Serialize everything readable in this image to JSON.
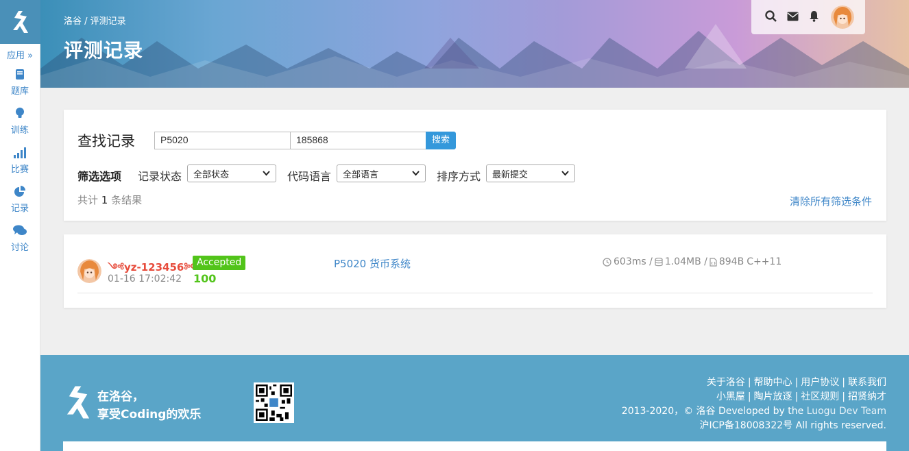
{
  "sidebar": {
    "apps_label": "应用 »",
    "items": [
      {
        "label": "题库",
        "icon": "book-icon"
      },
      {
        "label": "训练",
        "icon": "lightbulb-icon"
      },
      {
        "label": "比赛",
        "icon": "bar-chart-icon"
      },
      {
        "label": "记录",
        "icon": "pie-chart-icon"
      },
      {
        "label": "讨论",
        "icon": "comments-icon"
      }
    ]
  },
  "header": {
    "breadcrumb": "洛谷 / 评测记录",
    "title": "评测记录"
  },
  "search": {
    "find_label": "查找记录",
    "problem_value": "P5020",
    "user_value": "185868",
    "button_label": "搜索"
  },
  "filters": {
    "title": "筛选选项",
    "status_label": "记录状态",
    "status_value": "全部状态",
    "language_label": "代码语言",
    "language_value": "全部语言",
    "order_label": "排序方式",
    "order_value": "最新提交",
    "count_prefix": "共计",
    "count_value": "1",
    "count_suffix": "条结果",
    "clear_label": "清除所有筛选条件"
  },
  "record": {
    "username": "yz-123456",
    "time": "01-16 17:02:42",
    "status": "Accepted",
    "score": "100",
    "problem": "P5020 货币系统",
    "time_used": "603ms",
    "memory": "1.04MB",
    "code_size": "894B",
    "language": "C++11",
    "status_color": "#52c41a",
    "username_color": "#e74c3c"
  },
  "footer": {
    "slogan_line1": "在洛谷，",
    "slogan_line2": "享受Coding的欢乐",
    "links_row1": [
      "关于洛谷",
      "帮助中心",
      "用户协议",
      "联系我们"
    ],
    "links_row2": [
      "小黑屋",
      "陶片放逐",
      "社区规则",
      "招贤纳才"
    ],
    "copyright": "2013-2020，© 洛谷 Developed by the",
    "team": "Luogu Dev Team",
    "icp": "沪ICP备18008322号 All rights reserved."
  }
}
